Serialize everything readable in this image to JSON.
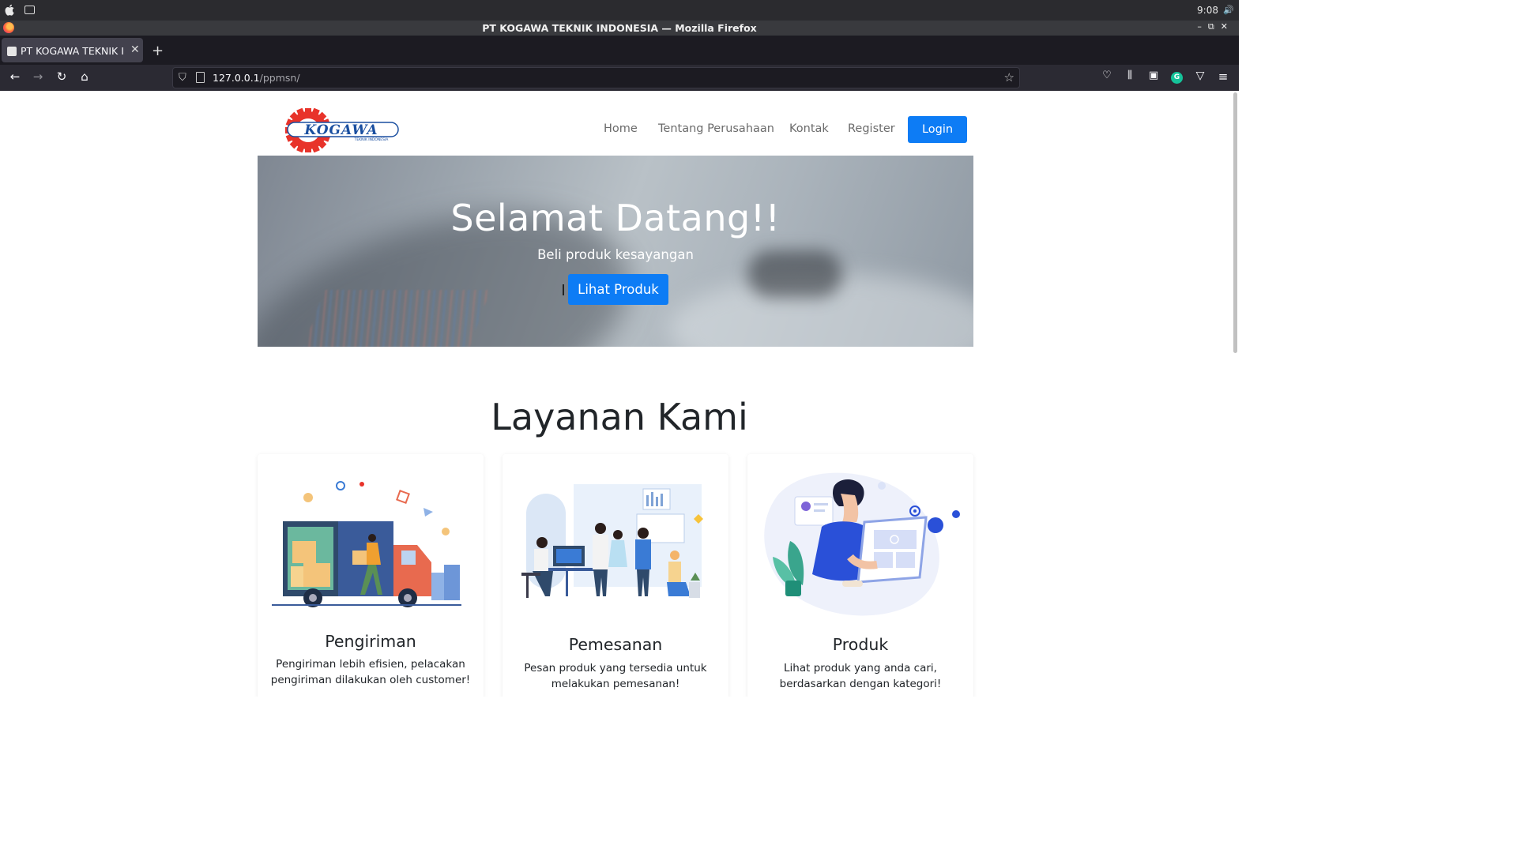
{
  "os": {
    "time": "9:08"
  },
  "window": {
    "title": "PT KOGAWA TEKNIK INDONESIA — Mozilla Firefox"
  },
  "browser": {
    "tab_title": "PT KOGAWA TEKNIK INDONESIA",
    "url_host": "127.0.0.1",
    "url_path": "/ppmsn/"
  },
  "site": {
    "logo_text": "KOGAWA",
    "logo_subtext": "TEKNIK INDONESIA",
    "nav": [
      "Home",
      "Tentang Perusahaan",
      "Kontak",
      "Register"
    ],
    "login_label": "Login"
  },
  "hero": {
    "title": "Selamat Datang!!",
    "subtitle": "Beli produk kesayangan",
    "button_label": "Lihat Produk"
  },
  "services": {
    "title": "Layanan Kami",
    "cards": [
      {
        "title": "Pengiriman",
        "text_line1": "Pengiriman lebih efisien, pelacakan",
        "text_line2": "pengiriman dilakukan oleh customer!"
      },
      {
        "title": "Pemesanan",
        "text_line1": "Pesan produk yang tersedia untuk",
        "text_line2": "melakukan pemesanan!"
      },
      {
        "title": "Produk",
        "text_line1": "Lihat produk yang anda cari,",
        "text_line2": "berdasarkan dengan kategori!"
      }
    ]
  },
  "colors": {
    "primary": "#0d7cf5",
    "logo_red": "#e8332a",
    "logo_blue": "#1a4fa0"
  }
}
